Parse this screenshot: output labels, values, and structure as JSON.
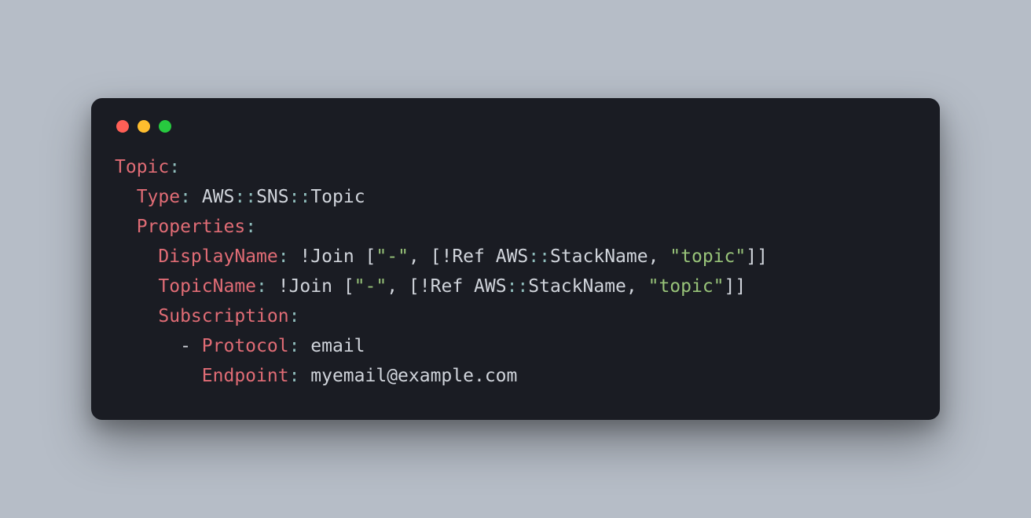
{
  "colors": {
    "background": "#b6bdc7",
    "window": "#1a1c23",
    "key": "#e06c75",
    "string": "#98c379",
    "punct": "#8fbcbb",
    "text": "#d0d4db",
    "dotRed": "#ff5f56",
    "dotYellow": "#ffbd2e",
    "dotGreen": "#27c93f"
  },
  "code": {
    "line1_key": "Topic",
    "colon": ":",
    "line2_key": "Type",
    "line2_val_a": "AWS",
    "line2_cc": "::",
    "line2_val_b": "SNS",
    "line2_val_c": "Topic",
    "line3_key": "Properties",
    "line4_key": "DisplayName",
    "join_fn": " !Join ",
    "open_br": "[",
    "dash_str": "\"-\"",
    "comma_sp": ", ",
    "ref_fn": "!Ref AWS",
    "stackname": "StackName",
    "topic_str": "\"topic\"",
    "close_br": "]]",
    "close_single": "]",
    "line5_key": "TopicName",
    "line6_key": "Subscription",
    "line7_dash": "- ",
    "line7_key": "Protocol",
    "line7_val": " email",
    "line8_key": "Endpoint",
    "line8_val": " myemail@example.com"
  }
}
